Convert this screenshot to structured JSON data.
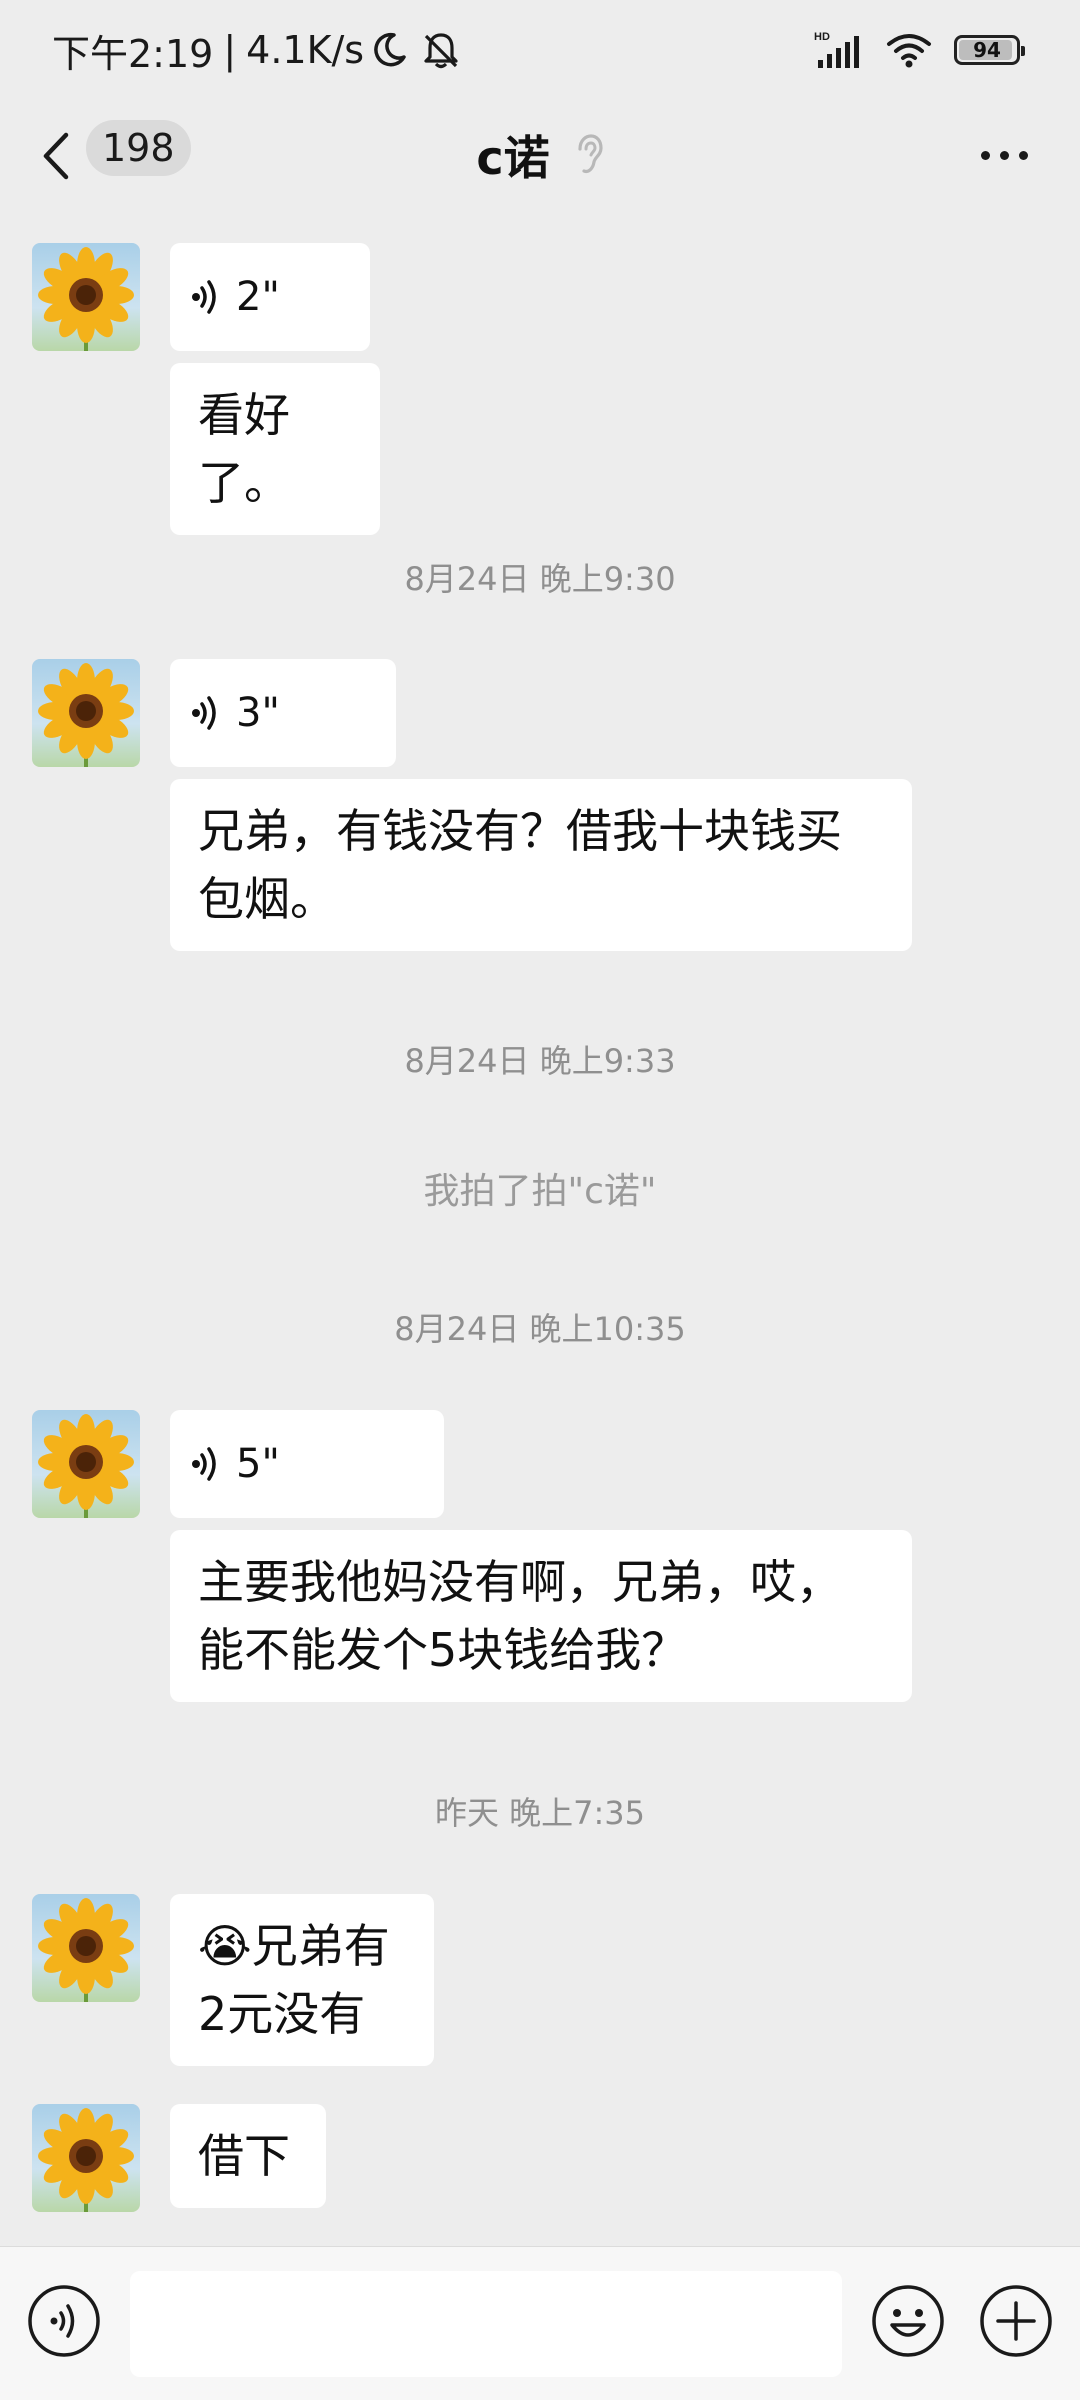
{
  "status_bar": {
    "time": "下午2:19",
    "separator": "|",
    "network_speed": "4.1K/s",
    "signal_label": "HD",
    "battery": "94",
    "battery_level": 0.94,
    "icons": [
      "moon-icon",
      "mute-bell-icon",
      "signal-icon",
      "wifi-icon",
      "battery-icon"
    ]
  },
  "header": {
    "unread_count": "198",
    "title": "c诺",
    "icons": [
      "back-icon",
      "ear-icon",
      "more-icon"
    ]
  },
  "messages": [
    {
      "type": "voice",
      "duration": "2\""
    },
    {
      "type": "text",
      "text": "看好了。"
    },
    {
      "type": "timestamp",
      "text": "8月24日 晚上9:30"
    },
    {
      "type": "voice",
      "duration": "3\""
    },
    {
      "type": "text",
      "text": "兄弟，有钱没有？借我十块钱买包烟。"
    },
    {
      "type": "timestamp",
      "text": "8月24日 晚上9:33"
    },
    {
      "type": "system",
      "text": "我拍了拍\"c诺\""
    },
    {
      "type": "timestamp",
      "text": "8月24日 晚上10:35"
    },
    {
      "type": "voice",
      "duration": "5\""
    },
    {
      "type": "text",
      "text": "主要我他妈没有啊，兄弟，哎，能不能发个5块钱给我？"
    },
    {
      "type": "timestamp",
      "text": "昨天 晚上7:35"
    },
    {
      "type": "text",
      "emoji": "😭",
      "text": "兄弟有2元没有"
    },
    {
      "type": "text",
      "text": "借下"
    }
  ],
  "input_bar": {
    "icons": [
      "voice-input-icon",
      "emoji-icon",
      "plus-icon"
    ]
  },
  "colors": {
    "background": "#ededed",
    "bubble": "#ffffff",
    "timestamp": "#8f8f8f"
  }
}
